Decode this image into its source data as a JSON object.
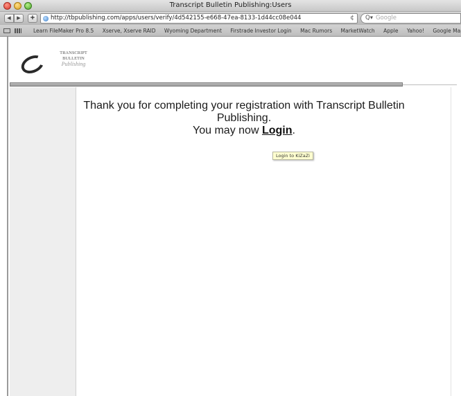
{
  "window": {
    "title": "Transcript Bulletin Publishing:Users"
  },
  "toolbar": {
    "back_glyph": "◀",
    "forward_glyph": "▶",
    "add_glyph": "+",
    "url": "http://tbpublishing.com/apps/users/verify/4d542155-e668-47ea-8133-1d44cc08e044",
    "reload_glyph": "¢",
    "search_placeholder": "Google",
    "search_glyph": "Q▾"
  },
  "bookmarks": [
    "Learn FileMaker Pro 8.5",
    "Xserve, Xserve RAID",
    "Wyoming Department",
    "Firstrade Investor Login",
    "Mac Rumors",
    "MarketWatch",
    "Apple",
    "Yahoo!",
    "Google Maps"
  ],
  "logo": {
    "line1": "TRANSCRIPT",
    "line2": "BULLETIN",
    "line3": "Publishing"
  },
  "main": {
    "thank_you": "Thank you for completing your registration with Transcript Bulletin Publishing.",
    "now_prefix": "You may now ",
    "login_label": "Login",
    "now_suffix": ".",
    "tooltip": "Login to KiZaZi"
  },
  "colors": {
    "sidebar_bg": "#eeeeee",
    "tooltip_bg": "#ffffd0",
    "divider": "#9c9c9c"
  }
}
